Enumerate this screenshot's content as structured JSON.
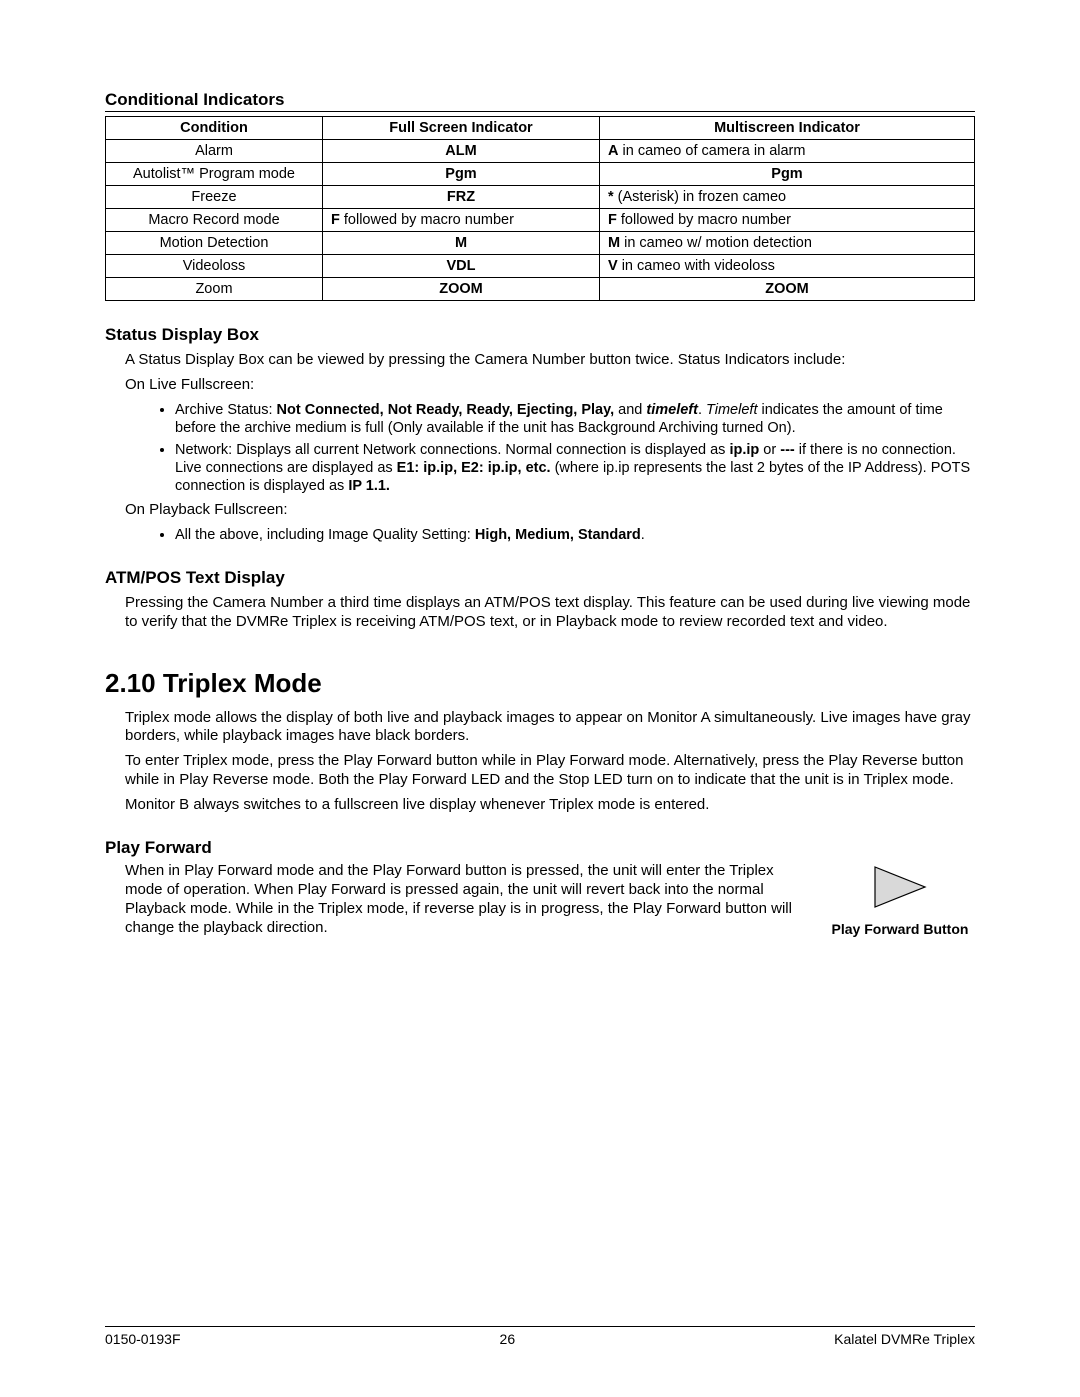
{
  "sections": {
    "cond_title": "Conditional Indicators",
    "status_title": "Status Display Box",
    "atm_title": "ATM/POS Text Display",
    "triplex_title": "2.10 Triplex Mode",
    "playfwd_title": "Play Forward"
  },
  "table": {
    "headers": [
      "Condition",
      "Full Screen Indicator",
      "Multiscreen Indicator"
    ],
    "rows": [
      {
        "c": "Alarm",
        "f": "ALM",
        "m_pre": "A",
        "m_rest": " in cameo of camera in alarm"
      },
      {
        "c": "Autolist™ Program mode",
        "f": "Pgm",
        "m_pre": "Pgm",
        "m_rest": ""
      },
      {
        "c": "Freeze",
        "f": "FRZ",
        "m_pre": "*",
        "m_rest": " (Asterisk) in frozen cameo"
      },
      {
        "c": "Macro Record mode",
        "f_pre": "F",
        "f_rest": " followed by macro number",
        "m_pre": "F",
        "m_rest": " followed by macro number"
      },
      {
        "c": "Motion Detection",
        "f": "M",
        "m_pre": "M",
        "m_rest": " in cameo w/ motion detection"
      },
      {
        "c": "Videoloss",
        "f": "VDL",
        "m_pre": "V",
        "m_rest": " in cameo with videoloss"
      },
      {
        "c": "Zoom",
        "f": "ZOOM",
        "m_pre": "ZOOM",
        "m_rest": ""
      }
    ]
  },
  "status": {
    "intro": "A Status Display Box can be viewed by pressing the Camera Number button twice.  Status Indicators include:",
    "live_label": "On Live Fullscreen:",
    "bullets_live": {
      "archive": {
        "pre": "Archive Status: ",
        "b": "Not Connected, Not Ready, Ready, Ejecting, Play,",
        "mid": " and ",
        "bi": "timeleft",
        "post1": ". ",
        "i": "Timeleft",
        "post2": " indicates the amount of time before the archive medium is full (Only available if the unit has Background Archiving turned On)."
      },
      "network": {
        "pre": "Network: Displays all current Network connections. Normal connection is displayed as ",
        "b1": "ip.ip",
        "mid1": " or ",
        "b2": "---",
        "mid2": " if there is no connection. Live connections are displayed as ",
        "b3": "E1: ip.ip, E2: ip.ip, etc.",
        "mid3": " (where ip.ip represents the last 2 bytes of the IP Address). POTS connection is displayed as ",
        "b4": "IP 1.1.",
        "post": ""
      }
    },
    "pb_label": "On Playback Fullscreen:",
    "bullet_pb": {
      "pre": "All the above, including Image Quality Setting: ",
      "b": "High, Medium, Standard",
      "post": "."
    }
  },
  "atm": {
    "text": "Pressing the Camera Number a third time displays an ATM/POS text display. This feature can be used during live viewing mode to verify that the DVMRe Triplex is receiving ATM/POS text, or in Playback mode to review recorded text and video."
  },
  "triplex": {
    "p1": "Triplex mode allows the display of both live and playback images to appear on Monitor A simultaneously.  Live images have gray borders, while playback images have black borders.",
    "p2": "To enter Triplex mode, press the Play Forward button while in Play Forward mode. Alternatively, press the Play Reverse button while in Play Reverse mode. Both the Play Forward LED and the Stop LED turn on to indicate that the unit is in Triplex mode.",
    "p3": "Monitor B always switches to a fullscreen live display whenever Triplex mode is entered."
  },
  "playfwd": {
    "text": "When in Play Forward mode and the Play Forward button is pressed, the unit will enter the Triplex mode of operation. When Play Forward is pressed again, the unit will revert back into the normal Playback mode. While in the Triplex mode, if reverse play is in progress, the Play Forward button will change the playback direction.",
    "caption": "Play Forward Button"
  },
  "footer": {
    "left": "0150-0193F",
    "center": "26",
    "right": "Kalatel DVMRe Triplex"
  }
}
